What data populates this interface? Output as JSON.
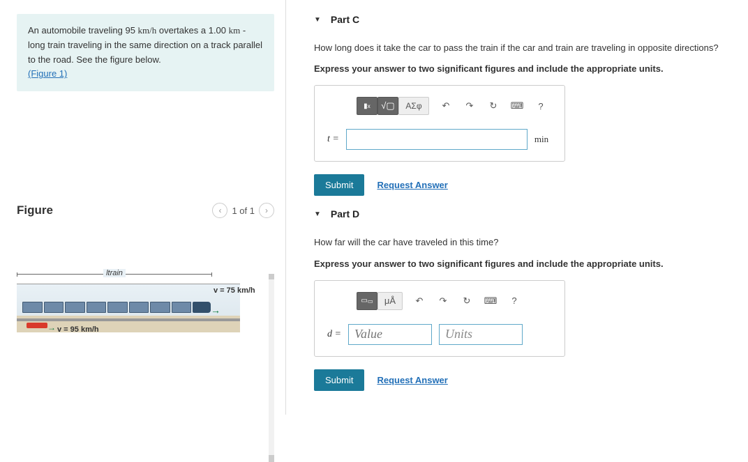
{
  "problem": {
    "text_prefix": "An automobile traveling 95 ",
    "unit1": "km/h",
    "text_mid1": " overtakes a 1.00 ",
    "unit2": "km",
    "text_mid2": " - long train traveling in the same direction on a track parallel to the road. See the figure below.",
    "figure_link": "(Figure 1)"
  },
  "figure": {
    "title": "Figure",
    "pager": "1 of 1",
    "ltrain_label": "ltrain",
    "v_train": "v = 75 km/h",
    "v_car": "v = 95 km/h"
  },
  "partC": {
    "title": "Part C",
    "question": "How long does it take the car to pass the train if the car and train are traveling in opposite directions?",
    "instruction": "Express your answer to two significant figures and include the appropriate units.",
    "toolbar": {
      "sqrt": "√",
      "sigma": "ΑΣφ",
      "help": "?"
    },
    "var": "t =",
    "units": "min",
    "submit": "Submit",
    "request": "Request Answer"
  },
  "partD": {
    "title": "Part D",
    "question": "How far will the car have traveled in this time?",
    "instruction": "Express your answer to two significant figures and include the appropriate units.",
    "toolbar": {
      "mu": "μÅ",
      "help": "?"
    },
    "var": "d =",
    "value_placeholder": "Value",
    "units_placeholder": "Units",
    "submit": "Submit",
    "request": "Request Answer"
  }
}
